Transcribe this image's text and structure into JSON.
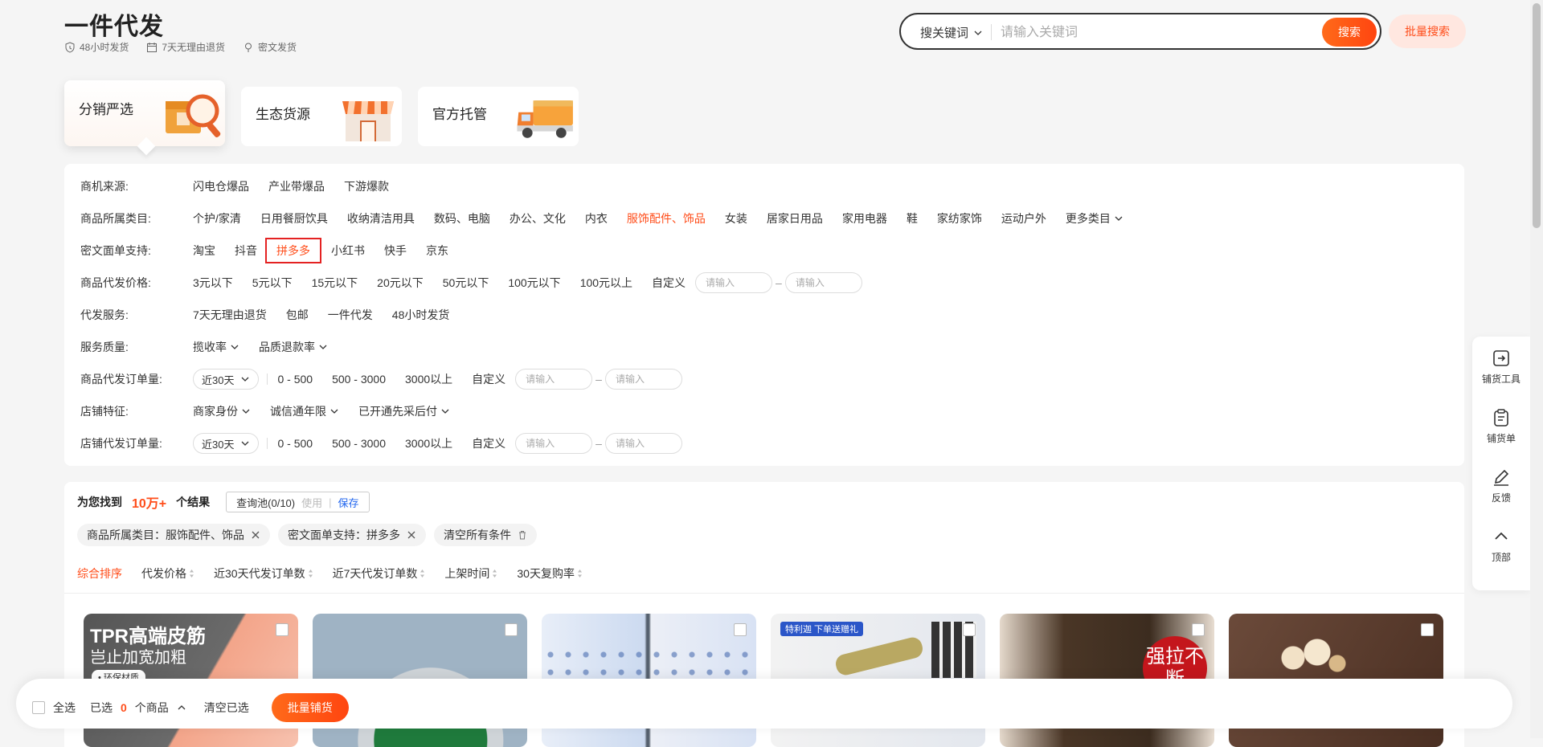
{
  "header": {
    "title": "一件代发",
    "promises": [
      "48小时发货",
      "7天无理由退货",
      "密文发货"
    ]
  },
  "search": {
    "type_label": "搜关键词",
    "placeholder": "请输入关键词",
    "button": "搜索",
    "batch_button": "批量搜索"
  },
  "cards": [
    {
      "label": "分销严选",
      "icon": "magnifier-box-icon",
      "active": true
    },
    {
      "label": "生态货源",
      "icon": "storefront-icon",
      "active": false
    },
    {
      "label": "官方托管",
      "icon": "delivery-truck-icon",
      "active": false
    }
  ],
  "filters": {
    "source": {
      "label": "商机来源:",
      "options": [
        "闪电仓爆品",
        "产业带爆品",
        "下游爆款"
      ]
    },
    "category": {
      "label": "商品所属类目:",
      "options": [
        "个护/家清",
        "日用餐厨饮具",
        "收纳清洁用具",
        "数码、电脑",
        "办公、文化",
        "内衣",
        "服饰配件、饰品",
        "女装",
        "居家日用品",
        "家用电器",
        "鞋",
        "家纺家饰",
        "运动户外"
      ],
      "selected": "服饰配件、饰品",
      "more": "更多类目"
    },
    "encrypted": {
      "label": "密文面单支持:",
      "options": [
        "淘宝",
        "抖音",
        "拼多多",
        "小红书",
        "快手",
        "京东"
      ],
      "selected": "拼多多"
    },
    "price": {
      "label": "商品代发价格:",
      "options": [
        "3元以下",
        "5元以下",
        "15元以下",
        "20元以下",
        "50元以下",
        "100元以下",
        "100元以上"
      ],
      "custom": "自定义",
      "input_placeholder": "请输入"
    },
    "service": {
      "label": "代发服务:",
      "options": [
        "7天无理由退货",
        "包邮",
        "一件代发",
        "48小时发货"
      ]
    },
    "quality": {
      "label": "服务质量:",
      "options": [
        "揽收率",
        "品质退款率"
      ]
    },
    "product_orders": {
      "label": "商品代发订单量:",
      "period": "近30天",
      "options": [
        "0 - 500",
        "500 - 3000",
        "3000以上"
      ],
      "custom": "自定义",
      "input_placeholder": "请输入"
    },
    "shop_features": {
      "label": "店铺特征:",
      "options": [
        "商家身份",
        "诚信通年限",
        "已开通先采后付"
      ]
    },
    "shop_orders": {
      "label": "店铺代发订单量:",
      "period": "近30天",
      "options": [
        "0 - 500",
        "500 - 3000",
        "3000以上"
      ],
      "custom": "自定义",
      "input_placeholder": "请输入"
    }
  },
  "results": {
    "found_prefix": "为您找到",
    "count": "10万+",
    "found_suffix": "个结果",
    "query_pool": "查询池(0/10)",
    "use": "使用",
    "save": "保存",
    "chips": [
      "商品所属类目：服饰配件、饰品",
      "密文面单支持：拼多多"
    ],
    "clear_all": "清空所有条件",
    "sort": [
      "综合排序",
      "代发价格",
      "近30天代发订单数",
      "近7天代发订单数",
      "上架时间",
      "30天复购率"
    ],
    "product_texts": {
      "p1_title": "TPR高端皮筋",
      "p1_sub": "岂止加宽加粗",
      "p1_tag": "• 环保材质",
      "p4_tag": "特利迦 下单送赠礼",
      "p5_badge": "强拉不断"
    }
  },
  "sidebar": [
    "铺货工具",
    "铺货单",
    "反馈",
    "顶部"
  ],
  "bottom_bar": {
    "select_all": "全选",
    "selected_prefix": "已选",
    "selected_count": "0",
    "selected_suffix": "个商品",
    "clear_selected": "清空已选",
    "batch_button": "批量铺货"
  },
  "colors": {
    "accent": "#ff4d1a",
    "link": "#2266ee",
    "background": "#f5f5f5"
  }
}
